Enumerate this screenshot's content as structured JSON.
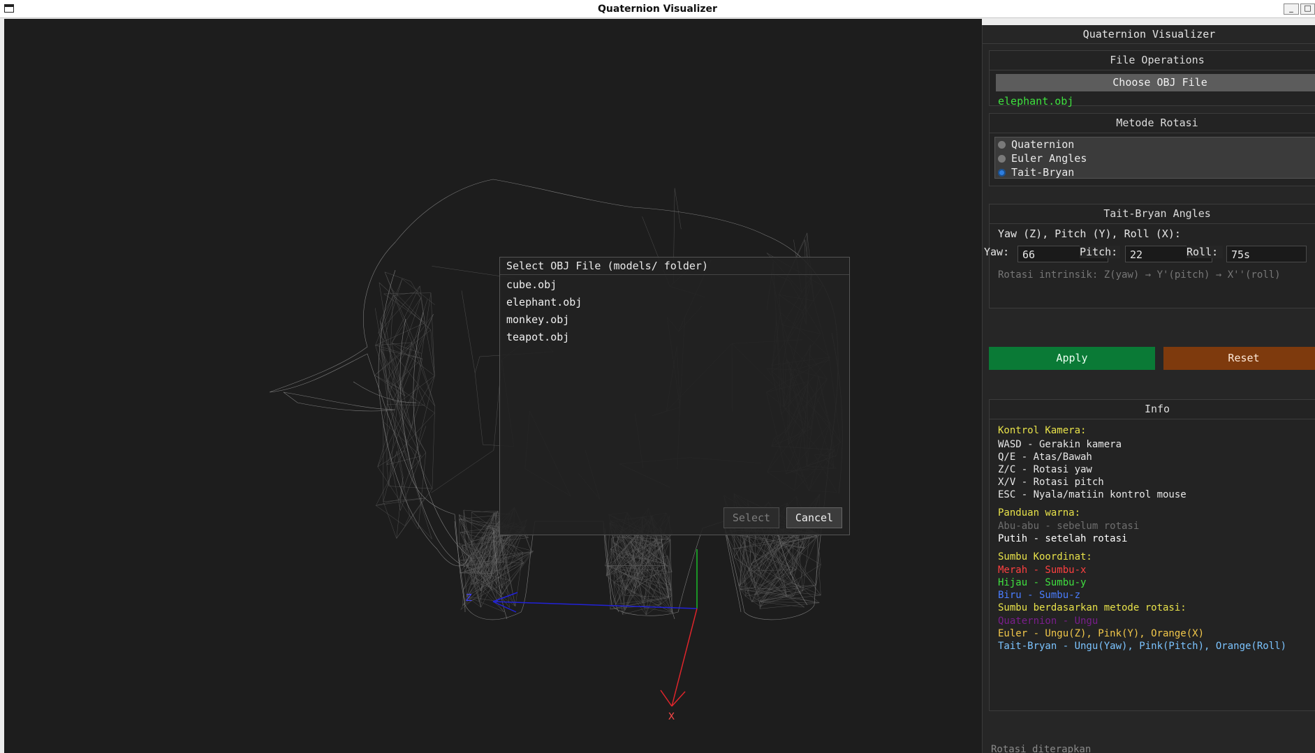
{
  "window": {
    "title": "Quaternion Visualizer",
    "min_label": "_",
    "max_label": "□"
  },
  "viewport": {
    "axis_labels": {
      "z": "Z",
      "x": "X"
    },
    "colors": {
      "x_axis": "#e0252b",
      "y_axis": "#1bbd2a",
      "z_axis": "#2222d8",
      "wireframe": "#8e8e8e",
      "background": "#1d1d1d"
    },
    "model": "elephant wireframe"
  },
  "panel": {
    "title": "Quaternion Visualizer",
    "file_ops": {
      "header": "File Operations",
      "choose_label": "Choose OBJ File",
      "current_file": "elephant.obj"
    },
    "method": {
      "header": "Metode Rotasi",
      "options": [
        "Quaternion",
        "Euler Angles",
        "Tait-Bryan"
      ],
      "selected": "Tait-Bryan"
    },
    "tait_bryan": {
      "header": "Tait-Bryan Angles",
      "subtitle": "Yaw (Z), Pitch (Y), Roll (X):",
      "yaw_label": "Yaw:",
      "yaw_value": "66",
      "pitch_label": "Pitch:",
      "pitch_value": "22",
      "roll_label": "Roll:",
      "roll_value": "75s",
      "note": "Rotasi intrinsik: Z(yaw) → Y'(pitch) → X''(roll)"
    },
    "apply_label": "Apply",
    "reset_label": "Reset",
    "info": {
      "header": "Info",
      "camera_title": "Kontrol Kamera:",
      "camera_lines": [
        "WASD - Gerakin kamera",
        "Q/E - Atas/Bawah",
        "Z/C - Rotasi yaw",
        "X/V - Rotasi pitch",
        "ESC - Nyala/matiin kontrol mouse"
      ],
      "color_title": "Panduan warna:",
      "color_before": "Abu-abu - sebelum rotasi",
      "color_after": "Putih - setelah rotasi",
      "axes_title": "Sumbu Koordinat:",
      "axis_x": "Merah - Sumbu-x",
      "axis_y": "Hijau - Sumbu-y",
      "axis_z": "Biru - Sumbu-z",
      "method_axes_title": "Sumbu berdasarkan metode rotasi:",
      "method_quat": "Quaternion - Ungu",
      "method_euler": "Euler - Ungu(Z), Pink(Y), Orange(X)",
      "method_tait": "Tait-Bryan - Ungu(Yaw), Pink(Pitch), Orange(Roll)"
    },
    "status": "Rotasi diterapkan"
  },
  "dialog": {
    "title": "Select OBJ File (models/ folder)",
    "files": [
      "cube.obj",
      "elephant.obj",
      "monkey.obj",
      "teapot.obj"
    ],
    "select_label": "Select",
    "cancel_label": "Cancel"
  }
}
